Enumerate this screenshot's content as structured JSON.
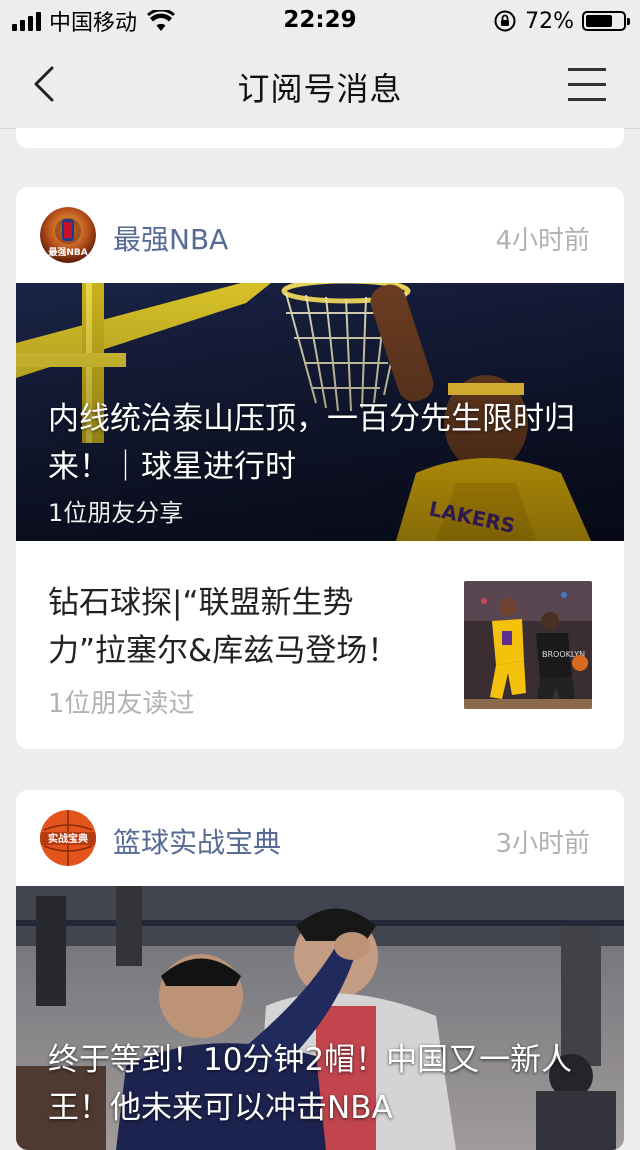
{
  "status_bar": {
    "carrier": "中国移动",
    "time": "22:29",
    "battery_percent": "72%",
    "battery_level": 0.72
  },
  "nav": {
    "title": "订阅号消息"
  },
  "cards": [
    {
      "account_name": "最强NBA",
      "avatar_text": "最强NBA",
      "time": "4小时前",
      "cover": {
        "title": "内线统治泰山压顶，一百分先生限时归来！｜球星进行时",
        "subtext": "1位朋友分享"
      },
      "sub_item": {
        "title": "钻石球探|“联盟新生势力”拉塞尔&库兹马登场！",
        "meta": "1位朋友读过"
      }
    },
    {
      "account_name": "篮球实战宝典",
      "avatar_text": "实战宝典",
      "time": "3小时前",
      "cover": {
        "title": "终于等到！10分钟2帽！中国又一新人王！他未来可以冲击NBA"
      }
    }
  ],
  "colors": {
    "background": "#ededed",
    "account_name": "#576b95",
    "muted": "#b2b2b2"
  }
}
